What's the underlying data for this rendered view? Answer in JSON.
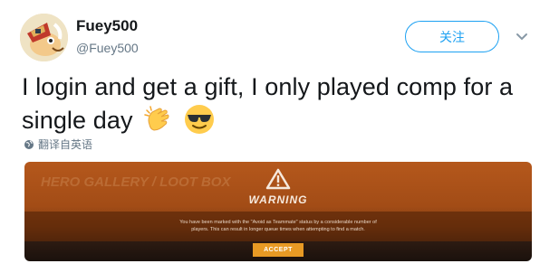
{
  "user": {
    "display_name": "Fuey500",
    "handle": "@Fuey500",
    "avatar_icon": "cartoon-avatar-icon"
  },
  "actions": {
    "follow_label": "关注",
    "menu_icon": "chevron-down-icon"
  },
  "tweet": {
    "text": "I login and get a gift, I only played comp for a single day",
    "emojis": [
      "clapping-hands-icon",
      "smiling-face-with-sunglasses-icon"
    ]
  },
  "translate": {
    "label": "翻译自英语",
    "icon": "globe-icon"
  },
  "media": {
    "warning_title": "WARNING",
    "warning_message": "You have been marked with the \"Avoid as Teammate\" status by a considerable number of players. This can result in longer queue times when attempting to find a match.",
    "accept_label": "ACCEPT",
    "background_text": "HERO GALLERY / LOOT BOX",
    "accent_color": "#e89a24"
  },
  "colors": {
    "accent": "#1da1f2",
    "secondary_text": "#657786",
    "primary_text": "#14171a"
  }
}
